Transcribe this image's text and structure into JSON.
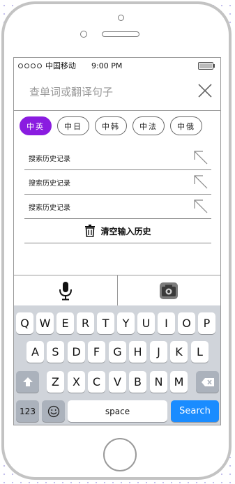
{
  "status_bar": {
    "carrier": "中国移动",
    "time": "9:00  PM"
  },
  "search": {
    "placeholder": "查单词或翻译句子"
  },
  "languages": [
    "中英",
    "中日",
    "中韩",
    "中法",
    "中俄"
  ],
  "active_language_index": 0,
  "history": {
    "items": [
      "搜索历史记录",
      "搜索历史记录",
      "搜索历史记录"
    ],
    "clear_label": "清空输入历史"
  },
  "keyboard": {
    "row1": [
      "Q",
      "W",
      "E",
      "R",
      "T",
      "Y",
      "U",
      "I",
      "O",
      "P"
    ],
    "row2": [
      "A",
      "S",
      "D",
      "F",
      "G",
      "H",
      "J",
      "K",
      "L"
    ],
    "row3": [
      "Z",
      "X",
      "C",
      "V",
      "B",
      "N",
      "M"
    ],
    "numbers_label": "123",
    "space_label": "space",
    "search_label": "Search"
  },
  "colors": {
    "accent": "#8a1ce0",
    "search_key": "#1a8cff",
    "keyboard_bg": "#d0d4da"
  }
}
